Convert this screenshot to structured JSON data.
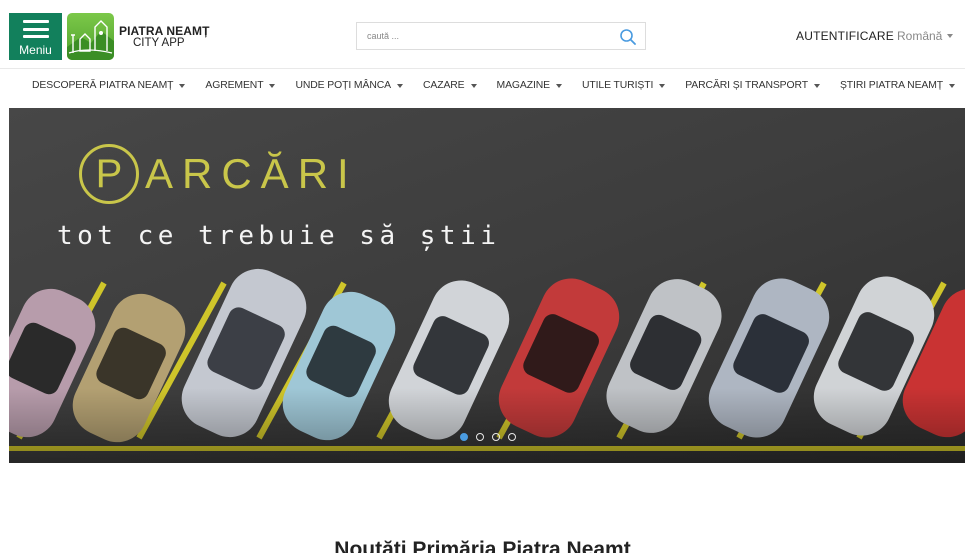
{
  "header": {
    "menu_label": "Meniu",
    "logo_line1": "PIATRA NEAMȚ",
    "logo_line2": "CITY APP",
    "search_placeholder": "caută ...",
    "auth_label": "AUTENTIFICARE",
    "language": "Română"
  },
  "nav": {
    "items": [
      {
        "label": "DESCOPERĂ PIATRA NEAMȚ"
      },
      {
        "label": "AGREMENT"
      },
      {
        "label": "UNDE POȚI MÂNCA"
      },
      {
        "label": "CAZARE"
      },
      {
        "label": "MAGAZINE"
      },
      {
        "label": "UTILE TURIȘTI"
      },
      {
        "label": "PARCĂRI ȘI TRANSPORT"
      },
      {
        "label": "ȘTIRI PIATRA NEAMȚ"
      }
    ]
  },
  "hero": {
    "p_letter": "P",
    "title": "ARCĂRI",
    "subtitle": "tot ce trebuie să știi",
    "slide_count": 4,
    "active_slide": 1
  },
  "section": {
    "title": "Noutăți Primăria Piatra Neamț"
  },
  "colors": {
    "brand_green": "#12805c",
    "accent_yellow": "#c9c64a",
    "active_dot": "#4a9be0"
  },
  "icons": {
    "menu": "hamburger-icon",
    "search": "search-icon",
    "dropdown": "caret-down-icon"
  }
}
